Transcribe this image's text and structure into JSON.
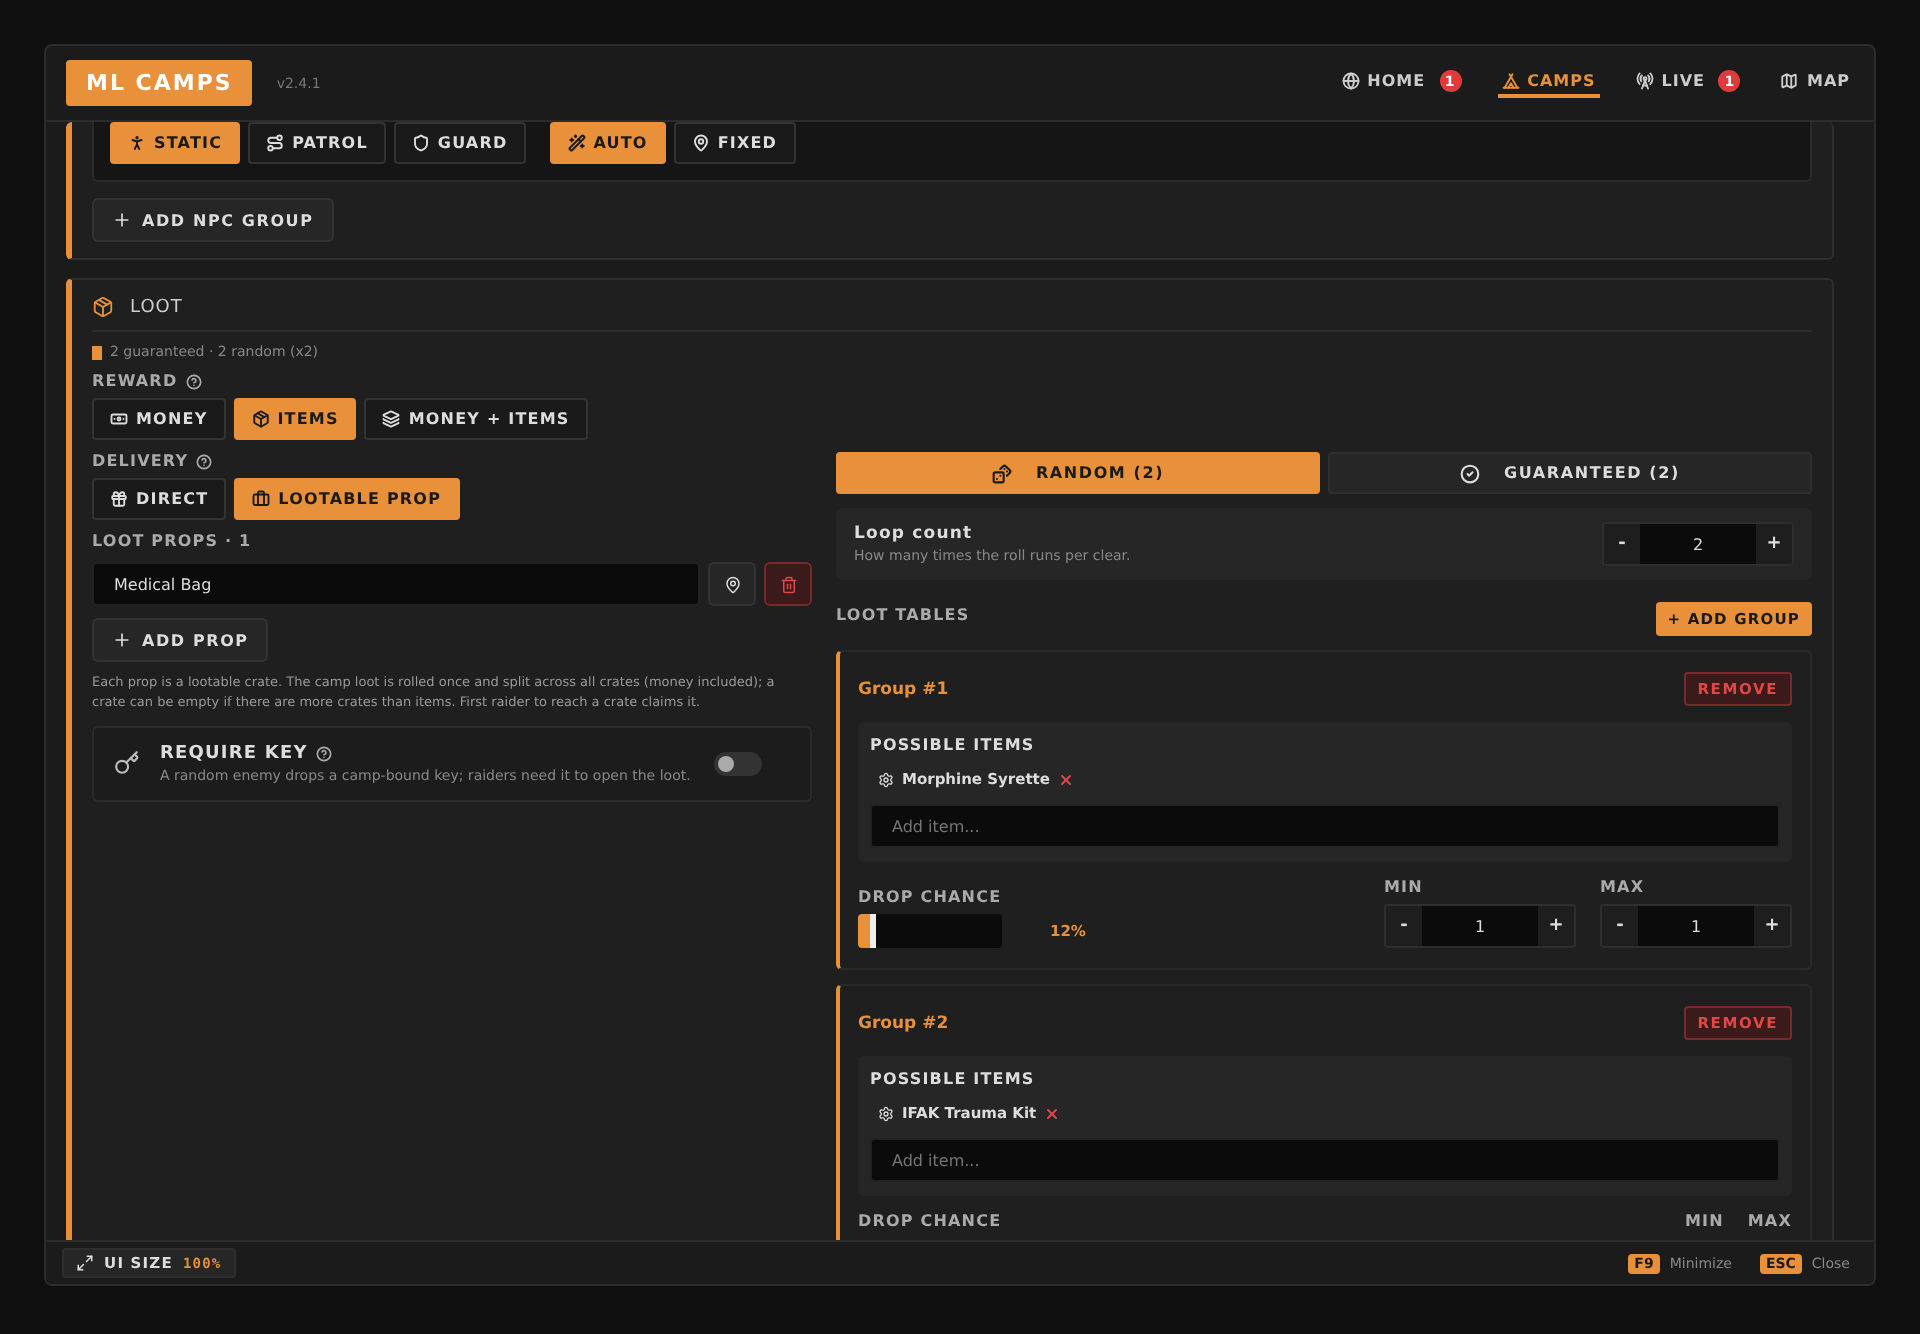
{
  "app": {
    "title": "ML CAMPS",
    "version": "v2.4.1"
  },
  "nav": [
    {
      "label": "HOME",
      "badge": "1",
      "selected": false
    },
    {
      "label": "CAMPS",
      "selected": true
    },
    {
      "label": "LIVE",
      "badge": "1",
      "selected": false
    },
    {
      "label": "MAP",
      "selected": false
    }
  ],
  "npc_group": {
    "options": [
      {
        "label": "STATIC",
        "selected": true
      },
      {
        "label": "PATROL",
        "selected": false
      },
      {
        "label": "GUARD",
        "selected": false
      },
      {
        "label": "AUTO",
        "selected": true
      },
      {
        "label": "FIXED",
        "selected": false
      }
    ],
    "add_button": "ADD NPC GROUP"
  },
  "loot": {
    "title": "LOOT",
    "summary": "2 guaranteed · 2 random (x2)",
    "reward": {
      "label": "REWARD",
      "options": [
        {
          "label": "MONEY",
          "selected": false
        },
        {
          "label": "ITEMS",
          "selected": true
        },
        {
          "label": "MONEY + ITEMS",
          "selected": false
        }
      ]
    },
    "delivery": {
      "label": "DELIVERY",
      "options": [
        {
          "label": "DIRECT",
          "selected": false
        },
        {
          "label": "LOOTABLE PROP",
          "selected": true
        }
      ]
    },
    "props": {
      "label": "LOOT PROPS · 1",
      "items": [
        {
          "value": "Medical Bag"
        }
      ],
      "add_button": "ADD PROP",
      "note": "Each prop is a lootable crate. The camp loot is rolled once and split across all crates (money included); a crate can be empty if there are more crates than items. First raider to reach a crate claims it."
    },
    "require_key": {
      "title": "REQUIRE KEY",
      "description": "A random enemy drops a camp-bound key; raiders need it to open the loot.",
      "on": false
    },
    "tabs": [
      {
        "label": "RANDOM (2)",
        "selected": true
      },
      {
        "label": "GUARANTEED (2)",
        "selected": false
      }
    ],
    "loop_count": {
      "title": "Loop count",
      "description": "How many times the roll runs per clear.",
      "minus": "-",
      "value": "2",
      "plus": "+"
    },
    "tables_label": "LOOT TABLES",
    "add_group": "+ ADD GROUP",
    "groups": [
      {
        "title": "Group #1",
        "remove": "REMOVE",
        "items_label": "POSSIBLE ITEMS",
        "items": [
          "Morphine Syrette"
        ],
        "placeholder": "Add item...",
        "drop_label": "DROP CHANCE",
        "level": 0.12,
        "reading": "12%",
        "min_label": "MIN",
        "min": {
          "minus": "-",
          "value": "1",
          "plus": "+"
        },
        "max_label": "MAX",
        "max": {
          "minus": "-",
          "value": "1",
          "plus": "+"
        }
      },
      {
        "title": "Group #2",
        "remove": "REMOVE",
        "items_label": "POSSIBLE ITEMS",
        "items": [
          "IFAK Trauma Kit"
        ],
        "placeholder": "Add item...",
        "drop_label": "DROP CHANCE",
        "min_label": "MIN",
        "max_label": "MAX"
      }
    ]
  },
  "footer": {
    "ui_size_label": "UI SIZE",
    "ui_size_value": "100%",
    "shortcuts": [
      {
        "key": "F9",
        "label": "Minimize"
      },
      {
        "key": "ESC",
        "label": "Close"
      }
    ]
  }
}
